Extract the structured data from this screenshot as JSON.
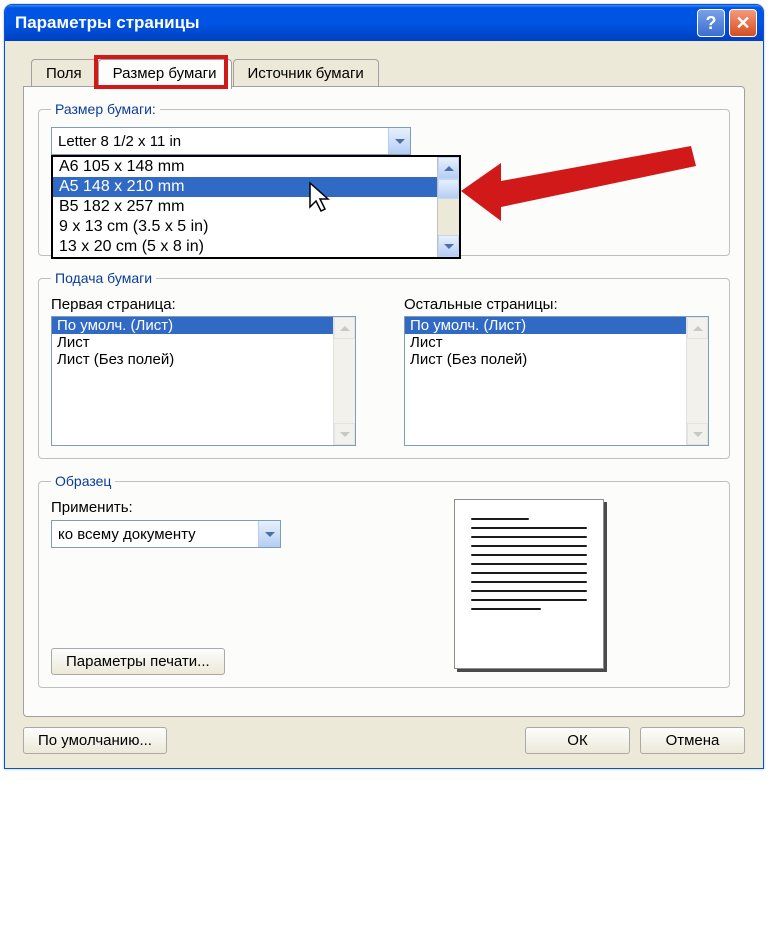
{
  "titlebar": {
    "title": "Параметры страницы"
  },
  "tabs": {
    "margins": "Поля",
    "paper": "Размер бумаги",
    "source": "Источник бумаги"
  },
  "paperSize": {
    "legend": "Размер бумаги:",
    "selected": "Letter 8 1/2 x 11 in",
    "options": [
      "A6 105 x 148 mm",
      "A5 148 x 210 mm",
      "B5 182 x 257 mm",
      "9 x 13 cm (3.5 x 5 in)",
      "13 x 20 cm (5 x 8 in)"
    ],
    "highlighted_index": 1
  },
  "paperFeed": {
    "legend": "Подача бумаги",
    "firstPage": {
      "label": "Первая страница:",
      "items": [
        "По умолч. (Лист)",
        "Лист",
        "Лист (Без полей)"
      ],
      "selected_index": 0
    },
    "otherPages": {
      "label": "Остальные страницы:",
      "items": [
        "По умолч. (Лист)",
        "Лист",
        "Лист (Без полей)"
      ],
      "selected_index": 0
    }
  },
  "sample": {
    "legend": "Образец",
    "applyLabel": "Применить:",
    "applyValue": "ко всему документу"
  },
  "buttons": {
    "printOptions": "Параметры печати...",
    "default": "По умолчанию...",
    "ok": "ОК",
    "cancel": "Отмена"
  }
}
